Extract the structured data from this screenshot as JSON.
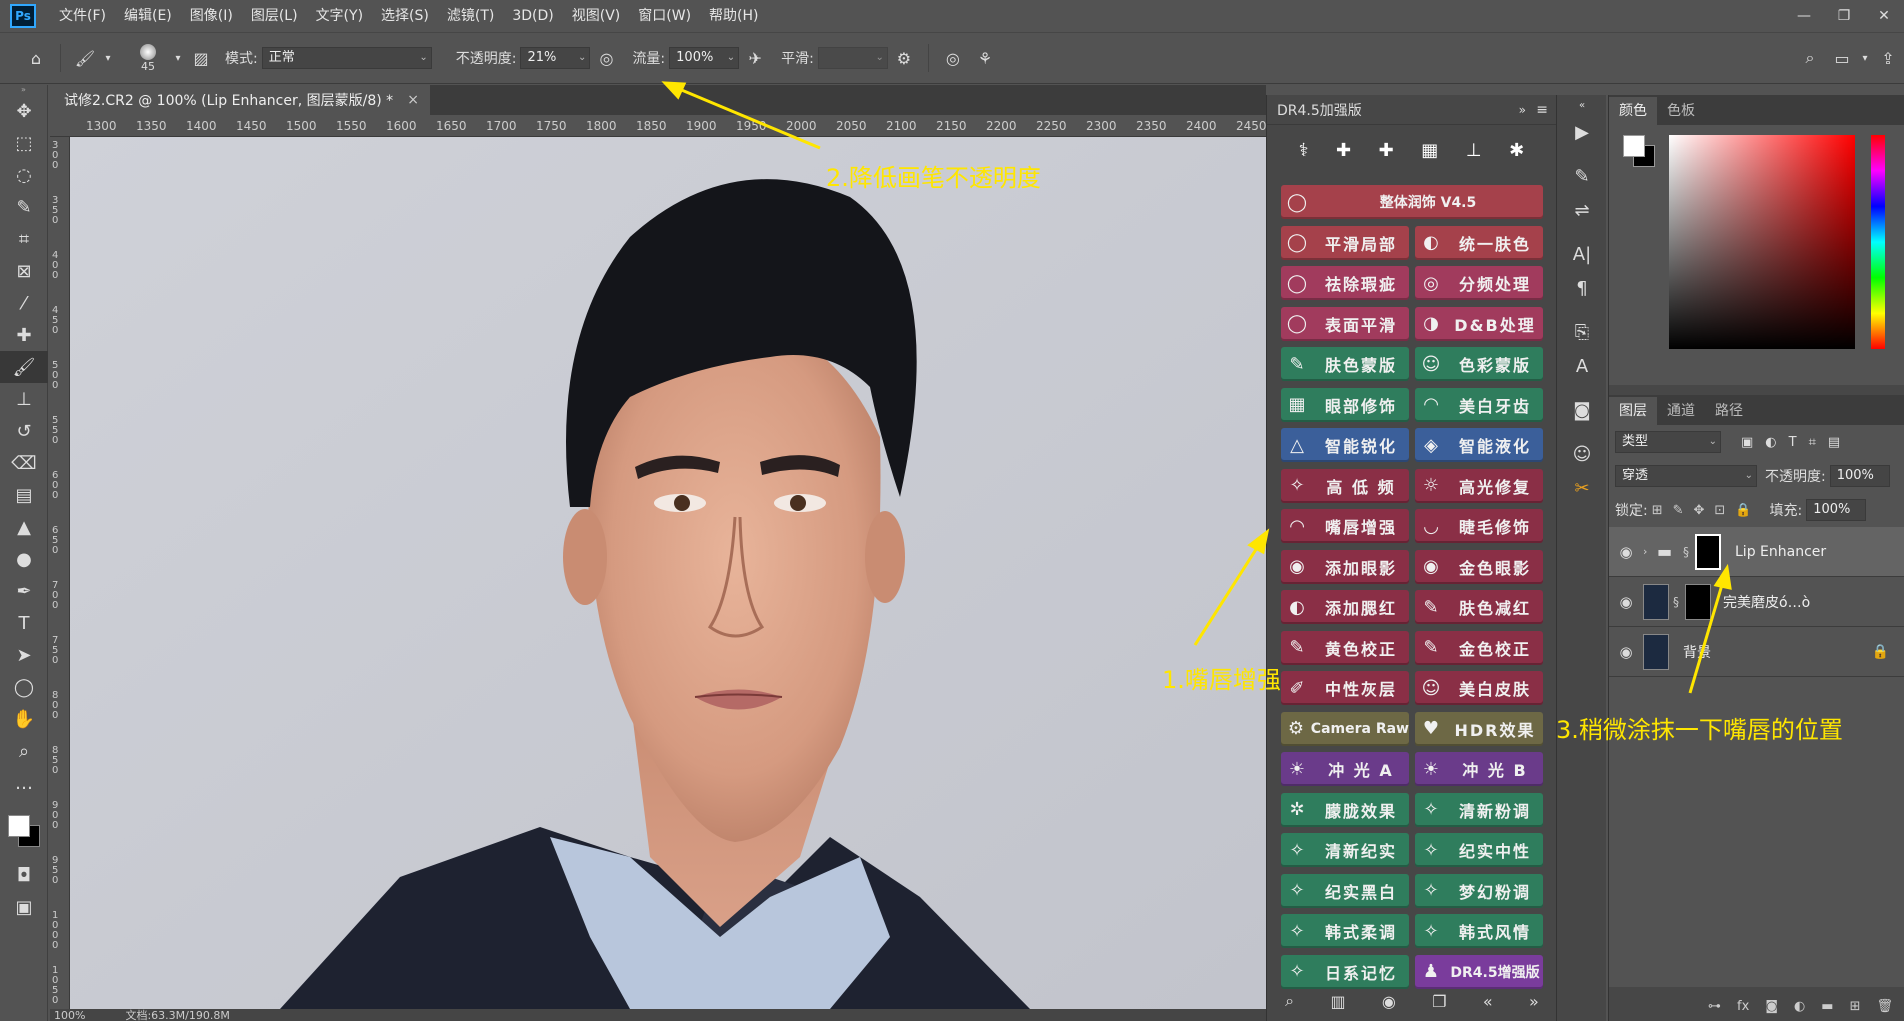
{
  "menu": {
    "logo": "Ps",
    "items": [
      "文件(F)",
      "编辑(E)",
      "图像(I)",
      "图层(L)",
      "文字(Y)",
      "选择(S)",
      "滤镜(T)",
      "3D(D)",
      "视图(V)",
      "窗口(W)",
      "帮助(H)"
    ]
  },
  "options": {
    "brush_size": "45",
    "mode_label": "模式:",
    "mode_value": "正常",
    "opacity_label": "不透明度:",
    "opacity_value": "21%",
    "flow_label": "流量:",
    "flow_value": "100%",
    "smooth_label": "平滑:",
    "smooth_value": ""
  },
  "document": {
    "tab_title": "试修2.CR2 @ 100% (Lip Enhancer, 图层蒙版/8) *",
    "tab_close": "×",
    "ruler_h": [
      "1300",
      "1350",
      "1400",
      "1450",
      "1500",
      "1550",
      "1600",
      "1650",
      "1700",
      "1750",
      "1800",
      "1850",
      "1900",
      "1950",
      "2000",
      "2050",
      "2100",
      "2150",
      "2200",
      "2250",
      "2300",
      "2350",
      "2400",
      "2450"
    ],
    "ruler_v": [
      "300",
      "350",
      "400",
      "450",
      "500",
      "550",
      "600",
      "650",
      "700",
      "750",
      "800",
      "850",
      "900",
      "950",
      "1000",
      "1050"
    ],
    "zoom": "100%",
    "doc_size": "文档:63.3M/190.8M"
  },
  "dr_panel": {
    "title": "DR4.5加强版",
    "buttons": [
      {
        "label": "整体润饰 V4.5",
        "icon": "◯",
        "color": "red"
      },
      {
        "label": "平滑局部",
        "icon": "◯",
        "color": "red"
      },
      {
        "label": "统一肤色",
        "icon": "◐",
        "color": "red"
      },
      {
        "label": "祛除瑕疵",
        "icon": "◯",
        "color": "pink"
      },
      {
        "label": "分频处理",
        "icon": "◎",
        "color": "pink"
      },
      {
        "label": "表面平滑",
        "icon": "◯",
        "color": "pink"
      },
      {
        "label": "D&B处理",
        "icon": "◑",
        "color": "pink"
      },
      {
        "label": "肤色蒙版",
        "icon": "✎",
        "color": "green"
      },
      {
        "label": "色彩蒙版",
        "icon": "☺",
        "color": "green"
      },
      {
        "label": "眼部修饰",
        "icon": "▦",
        "color": "green"
      },
      {
        "label": "美白牙齿",
        "icon": "◠",
        "color": "green"
      },
      {
        "label": "智能锐化",
        "icon": "△",
        "color": "blue"
      },
      {
        "label": "智能液化",
        "icon": "◈",
        "color": "blue"
      },
      {
        "label": "高 低 频",
        "icon": "✧",
        "color": "maroon"
      },
      {
        "label": "高光修复",
        "icon": "☼",
        "color": "maroon"
      },
      {
        "label": "嘴唇增强",
        "icon": "◠",
        "color": "maroon"
      },
      {
        "label": "睫毛修饰",
        "icon": "◡",
        "color": "maroon"
      },
      {
        "label": "添加眼影",
        "icon": "◉",
        "color": "maroon"
      },
      {
        "label": "金色眼影",
        "icon": "◉",
        "color": "maroon"
      },
      {
        "label": "添加腮红",
        "icon": "◐",
        "color": "maroon"
      },
      {
        "label": "肤色减红",
        "icon": "✎",
        "color": "maroon"
      },
      {
        "label": "黄色校正",
        "icon": "✎",
        "color": "maroon"
      },
      {
        "label": "金色校正",
        "icon": "✎",
        "color": "maroon"
      },
      {
        "label": "中性灰层",
        "icon": "✐",
        "color": "maroon"
      },
      {
        "label": "美白皮肤",
        "icon": "☺",
        "color": "maroon"
      },
      {
        "label": "Camera Raw",
        "icon": "⚙",
        "color": "olive"
      },
      {
        "label": "HDR效果",
        "icon": "♥",
        "color": "olive"
      },
      {
        "label": "冲 光 A",
        "icon": "☀",
        "color": "purple"
      },
      {
        "label": "冲 光 B",
        "icon": "☀",
        "color": "purple"
      },
      {
        "label": "朦胧效果",
        "icon": "✲",
        "color": "green"
      },
      {
        "label": "清新粉调",
        "icon": "✧",
        "color": "green"
      },
      {
        "label": "清新纪实",
        "icon": "✧",
        "color": "green"
      },
      {
        "label": "纪实中性",
        "icon": "✧",
        "color": "green"
      },
      {
        "label": "纪实黑白",
        "icon": "✧",
        "color": "green"
      },
      {
        "label": "梦幻粉调",
        "icon": "✧",
        "color": "green"
      },
      {
        "label": "韩式柔调",
        "icon": "✧",
        "color": "green"
      },
      {
        "label": "韩式风情",
        "icon": "✧",
        "color": "green"
      },
      {
        "label": "日系记忆",
        "icon": "✧",
        "color": "green"
      },
      {
        "label": "DR4.5增强版",
        "icon": "♟",
        "color": "violet"
      }
    ]
  },
  "color_panel": {
    "tab_color": "颜色",
    "tab_swatches": "色板"
  },
  "layers_panel": {
    "tab_layers": "图层",
    "tab_channels": "通道",
    "tab_paths": "路径",
    "filter_kind": "类型",
    "blend_mode": "穿透",
    "opacity_label": "不透明度:",
    "opacity_value": "100%",
    "lock_label": "锁定:",
    "fill_label": "填充:",
    "fill_value": "100%",
    "layers": [
      {
        "name": "Lip Enhancer"
      },
      {
        "name": "完美磨皮ó…ò"
      },
      {
        "name": "背景"
      }
    ]
  },
  "annotations": {
    "step1": "1.嘴唇增强",
    "step2": "2.降低画笔不透明度",
    "step3": "3.稍微涂抹一下嘴唇的位置"
  },
  "colors": {
    "annotation": "#ffe600",
    "accent": "#31a8ff"
  }
}
